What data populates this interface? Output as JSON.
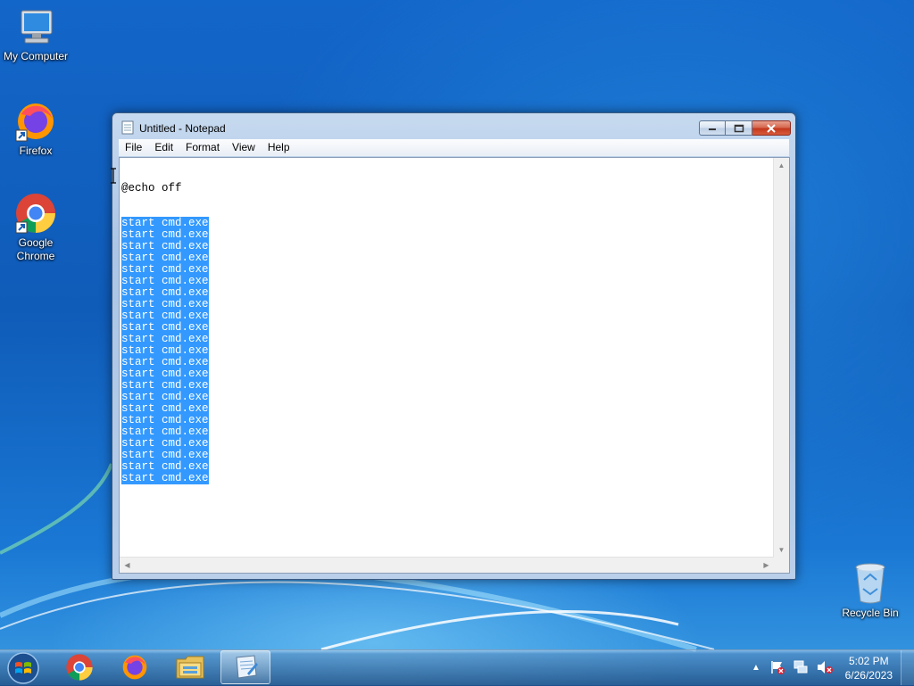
{
  "desktop": {
    "icons": [
      {
        "label": "My Computer"
      },
      {
        "label": "Firefox"
      },
      {
        "label": "Google Chrome"
      },
      {
        "label": "Recycle Bin"
      }
    ]
  },
  "notepad": {
    "title": "Untitled - Notepad",
    "menu": [
      "File",
      "Edit",
      "Format",
      "View",
      "Help"
    ],
    "first_line": "@echo off",
    "selected_lines": [
      "start cmd.exe",
      "start cmd.exe",
      "start cmd.exe",
      "start cmd.exe",
      "start cmd.exe",
      "start cmd.exe",
      "start cmd.exe",
      "start cmd.exe",
      "start cmd.exe",
      "start cmd.exe",
      "start cmd.exe",
      "start cmd.exe",
      "start cmd.exe",
      "start cmd.exe",
      "start cmd.exe",
      "start cmd.exe",
      "start cmd.exe",
      "start cmd.exe",
      "start cmd.exe",
      "start cmd.exe",
      "start cmd.exe",
      "start cmd.exe",
      "start cmd.exe"
    ],
    "selection_color": "#3399ff"
  },
  "taskbar": {
    "apps": [
      "chrome-icon",
      "firefox-icon",
      "file-explorer-icon",
      "notepad-icon"
    ],
    "active_app": "notepad-icon",
    "tray_icons": [
      "show-hidden-icons-arrow",
      "action-center-flag-icon",
      "network-icon",
      "volume-muted-icon"
    ],
    "clock_time": "5:02 PM",
    "clock_date": "6/26/2023"
  }
}
